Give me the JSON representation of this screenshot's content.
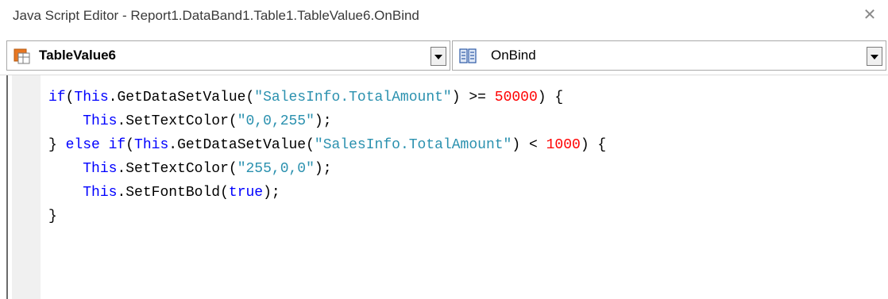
{
  "window": {
    "title": "Java Script Editor - Report1.DataBand1.Table1.TableValue6.OnBind",
    "close_glyph": "✕"
  },
  "toolbar": {
    "object_combo": {
      "selected": "TableValue6",
      "icon": "table-value-icon"
    },
    "event_combo": {
      "selected": "OnBind",
      "icon": "event-icon"
    }
  },
  "editor": {
    "lines": [
      [
        {
          "t": "kw",
          "v": "if"
        },
        {
          "t": "punc",
          "v": "("
        },
        {
          "t": "obj",
          "v": "This"
        },
        {
          "t": "punc",
          "v": "."
        },
        {
          "t": "ident",
          "v": "GetDataSetValue"
        },
        {
          "t": "punc",
          "v": "("
        },
        {
          "t": "str",
          "v": "\"SalesInfo.TotalAmount\""
        },
        {
          "t": "punc",
          "v": ") >= "
        },
        {
          "t": "num",
          "v": "50000"
        },
        {
          "t": "punc",
          "v": ") {"
        }
      ],
      [
        {
          "t": "punc",
          "v": "    "
        },
        {
          "t": "obj",
          "v": "This"
        },
        {
          "t": "punc",
          "v": "."
        },
        {
          "t": "ident",
          "v": "SetTextColor"
        },
        {
          "t": "punc",
          "v": "("
        },
        {
          "t": "str",
          "v": "\"0,0,255\""
        },
        {
          "t": "punc",
          "v": ");"
        }
      ],
      [
        {
          "t": "punc",
          "v": "} "
        },
        {
          "t": "kw",
          "v": "else if"
        },
        {
          "t": "punc",
          "v": "("
        },
        {
          "t": "obj",
          "v": "This"
        },
        {
          "t": "punc",
          "v": "."
        },
        {
          "t": "ident",
          "v": "GetDataSetValue"
        },
        {
          "t": "punc",
          "v": "("
        },
        {
          "t": "str",
          "v": "\"SalesInfo.TotalAmount\""
        },
        {
          "t": "punc",
          "v": ") < "
        },
        {
          "t": "num",
          "v": "1000"
        },
        {
          "t": "punc",
          "v": ") {"
        }
      ],
      [
        {
          "t": "punc",
          "v": "    "
        },
        {
          "t": "obj",
          "v": "This"
        },
        {
          "t": "punc",
          "v": "."
        },
        {
          "t": "ident",
          "v": "SetTextColor"
        },
        {
          "t": "punc",
          "v": "("
        },
        {
          "t": "str",
          "v": "\"255,0,0\""
        },
        {
          "t": "punc",
          "v": ");"
        }
      ],
      [
        {
          "t": "punc",
          "v": "    "
        },
        {
          "t": "obj",
          "v": "This"
        },
        {
          "t": "punc",
          "v": "."
        },
        {
          "t": "ident",
          "v": "SetFontBold"
        },
        {
          "t": "punc",
          "v": "("
        },
        {
          "t": "kw",
          "v": "true"
        },
        {
          "t": "punc",
          "v": ");"
        }
      ],
      [
        {
          "t": "punc",
          "v": "}"
        }
      ]
    ]
  },
  "colors": {
    "keyword": "#0000ff",
    "string": "#2b91af",
    "number": "#ff0000",
    "gutter": "#f0f0f0"
  }
}
